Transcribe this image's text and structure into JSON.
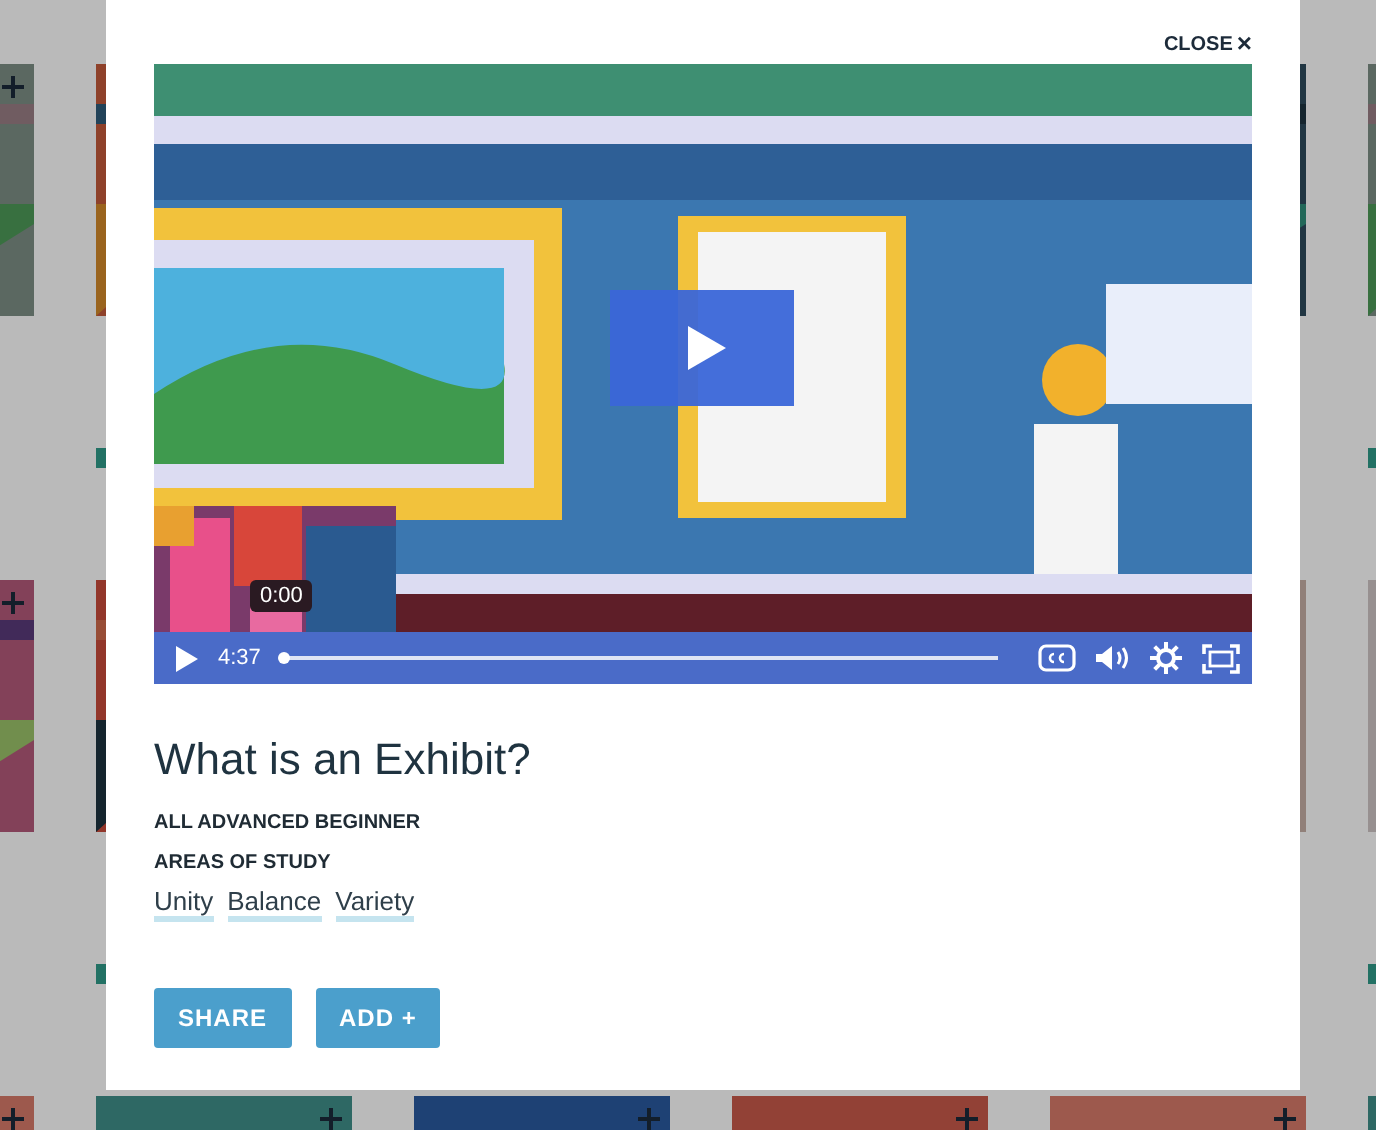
{
  "modal": {
    "close_button": {
      "label": "CLOSE",
      "icon": "×"
    },
    "video": {
      "scrub_tooltip": "0:00",
      "duration": "4:37",
      "progress": {
        "level": 0
      }
    },
    "title": "What is an Exhibit?",
    "levels": "ALL ADVANCED BEGINNER",
    "areas_heading": "AREAS OF STUDY",
    "areas": [
      "Unity",
      "Balance",
      "Variety"
    ],
    "buttons": [
      {
        "label": "SHARE"
      },
      {
        "label": "ADD +"
      }
    ]
  }
}
